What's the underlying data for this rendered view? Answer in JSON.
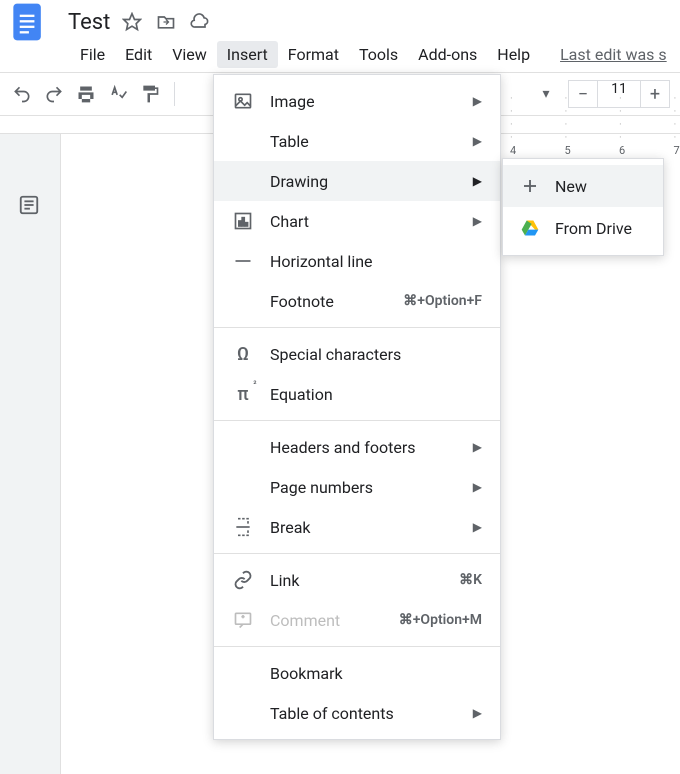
{
  "doc": {
    "title": "Test",
    "last_edit": "Last edit was s"
  },
  "menubar": [
    "File",
    "Edit",
    "View",
    "Insert",
    "Format",
    "Tools",
    "Add-ons",
    "Help"
  ],
  "menubar_active_index": 3,
  "toolbar": {
    "font_size": "11"
  },
  "ruler": [
    "4",
    "5",
    "6",
    "7"
  ],
  "insert_menu": [
    {
      "label": "Image",
      "icon": "image",
      "arrow": true
    },
    {
      "label": "Table",
      "arrow": true
    },
    {
      "label": "Drawing",
      "arrow": true,
      "hover": true
    },
    {
      "label": "Chart",
      "icon": "chart",
      "arrow": true
    },
    {
      "label": "Horizontal line",
      "icon": "hline"
    },
    {
      "label": "Footnote",
      "shortcut": "⌘+Option+F"
    },
    {
      "divider": true
    },
    {
      "label": "Special characters",
      "icon": "omega"
    },
    {
      "label": "Equation",
      "icon": "pi"
    },
    {
      "divider": true
    },
    {
      "label": "Headers and footers",
      "arrow": true
    },
    {
      "label": "Page numbers",
      "arrow": true
    },
    {
      "label": "Break",
      "icon": "break",
      "arrow": true
    },
    {
      "divider": true
    },
    {
      "label": "Link",
      "icon": "link",
      "shortcut": "⌘K"
    },
    {
      "label": "Comment",
      "icon": "comment",
      "shortcut": "⌘+Option+M",
      "disabled": true
    },
    {
      "divider": true
    },
    {
      "label": "Bookmark"
    },
    {
      "label": "Table of contents",
      "arrow": true
    }
  ],
  "drawing_submenu": [
    {
      "label": "New",
      "icon": "plus",
      "hover": true
    },
    {
      "label": "From Drive",
      "icon": "drive"
    }
  ]
}
